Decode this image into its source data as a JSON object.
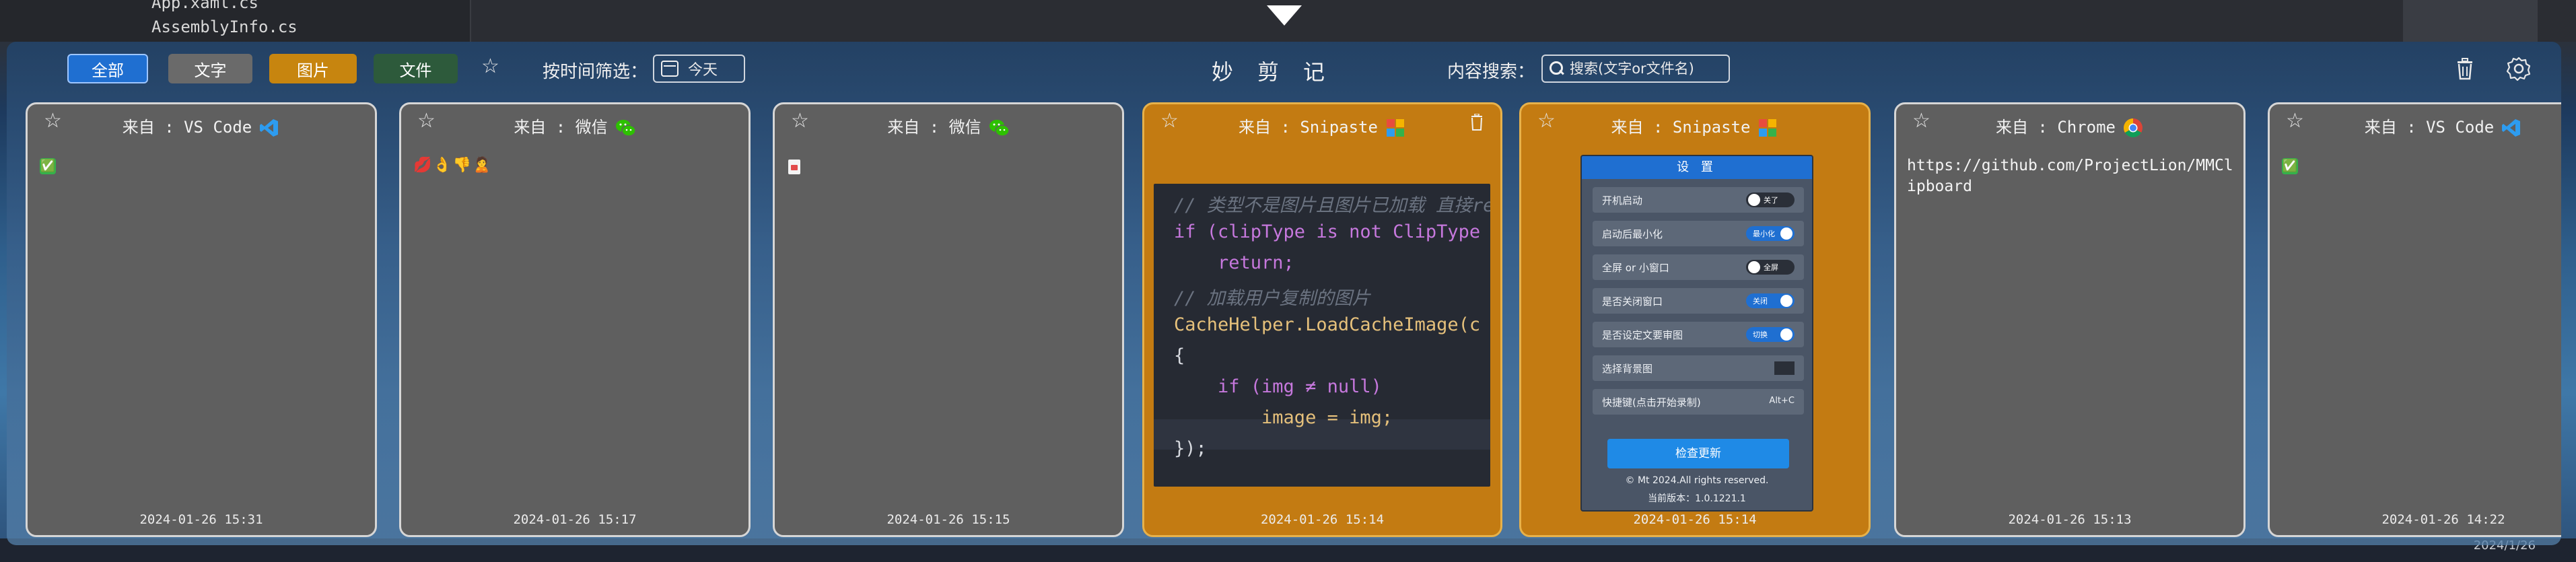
{
  "ide_background": {
    "files": [
      "App.xaml.cs",
      "AssemblyInfo.cs"
    ],
    "taskbar_date": "2024/1/26"
  },
  "toolbar": {
    "filters": [
      {
        "label": "全部",
        "color": "#1f6fd1",
        "active": true
      },
      {
        "label": "文字",
        "color": "#6a6a6a",
        "active": false
      },
      {
        "label": "图片",
        "color": "#c7850f",
        "active": false
      },
      {
        "label": "文件",
        "color": "#2d5a3b",
        "active": false
      }
    ],
    "favorites_icon": "star-outline-icon",
    "time_filter_label": "按时间筛选：",
    "date_value": "今天",
    "app_title": "妙剪记",
    "search_label": "内容搜索：",
    "search_placeholder": "搜索(文字or文件名)",
    "clear_icon": "trash-icon",
    "settings_icon": "gear-icon"
  },
  "cards": [
    {
      "source_label": "来自 : VS Code",
      "source_icon": "vscode-icon",
      "content_type": "emoji",
      "content": "✅",
      "timestamp": "2024-01-26 15:31",
      "style": "gray"
    },
    {
      "source_label": "来自 : 微信",
      "source_icon": "wechat-icon",
      "content_type": "emoji",
      "content": "💋👌👎🙎",
      "timestamp": "2024-01-26 15:17",
      "style": "gray"
    },
    {
      "source_label": "来自 : 微信",
      "source_icon": "wechat-icon",
      "content_type": "file",
      "content": "",
      "timestamp": "2024-01-26 15:15",
      "style": "gray"
    },
    {
      "source_label": "来自 : Snipaste",
      "source_icon": "snipaste-icon",
      "content_type": "image-code",
      "content": "",
      "timestamp": "2024-01-26 15:14",
      "style": "orange"
    },
    {
      "source_label": "来自 : Snipaste",
      "source_icon": "snipaste-icon",
      "content_type": "image-settings",
      "content": "",
      "timestamp": "2024-01-26 15:14",
      "style": "orange"
    },
    {
      "source_label": "来自 : Chrome",
      "source_icon": "chrome-icon",
      "content_type": "text",
      "content": "https://github.com/ProjectLion/MMClipboard",
      "timestamp": "2024-01-26 15:13",
      "style": "gray"
    },
    {
      "source_label": "来自 : VS Code",
      "source_icon": "vscode-icon",
      "content_type": "emoji",
      "content": "✅",
      "timestamp": "2024-01-26 14:22",
      "style": "gray"
    }
  ],
  "code_snippet": [
    "// 类型不是图片且图片已加载 直接re",
    "if (clipType is not ClipType",
    "    return;",
    "// 加载用户复制的图片",
    "CacheHelper.LoadCacheImage(c",
    "{",
    "    if (img ≠ null)",
    "        image = img;",
    "});"
  ],
  "settings_preview": {
    "title": "设 置",
    "rows": [
      {
        "label": "开机启动",
        "toggle_text": "关了",
        "on": false
      },
      {
        "label": "启动后最小化",
        "toggle_text": "最小化",
        "on": true
      },
      {
        "label": "全屏 or 小窗口",
        "toggle_text": "全屏",
        "on": false
      },
      {
        "label": "是否关闭窗口",
        "toggle_text": "关闭",
        "on": true
      },
      {
        "label": "是否设定文要审图",
        "toggle_text": "切换",
        "on": true
      },
      {
        "label": "选择背景图",
        "toggle_text": "",
        "on": false
      },
      {
        "label": "快捷键(点击开始录制)",
        "toggle_text": "Alt+C",
        "on": false
      }
    ],
    "button": "检查更新",
    "copyright": "© Mt 2024.All rights reserved.",
    "version": "当前版本：1.0.1221.1"
  }
}
